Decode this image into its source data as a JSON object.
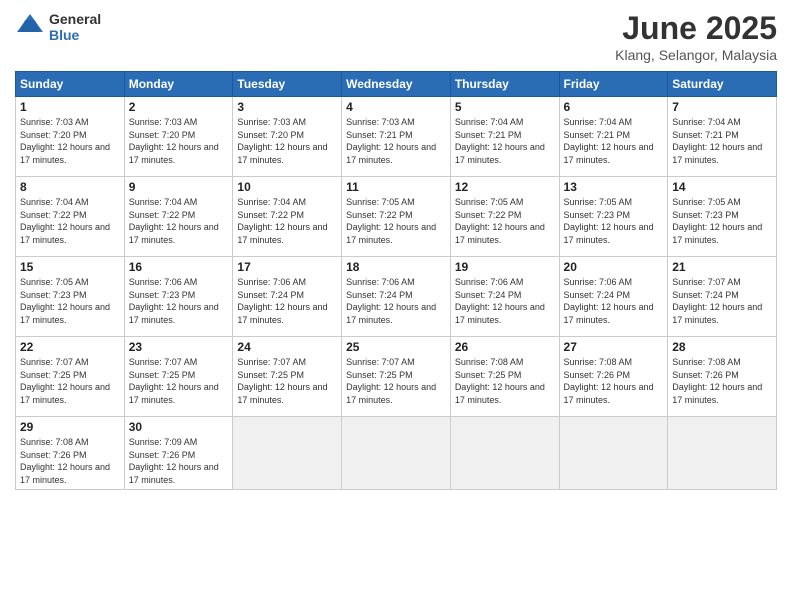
{
  "logo": {
    "general": "General",
    "blue": "Blue"
  },
  "title": "June 2025",
  "subtitle": "Klang, Selangor, Malaysia",
  "headers": [
    "Sunday",
    "Monday",
    "Tuesday",
    "Wednesday",
    "Thursday",
    "Friday",
    "Saturday"
  ],
  "weeks": [
    [
      {
        "day": "1",
        "rise": "7:03 AM",
        "set": "7:20 PM",
        "daylight": "12 hours and 17 minutes."
      },
      {
        "day": "2",
        "rise": "7:03 AM",
        "set": "7:20 PM",
        "daylight": "12 hours and 17 minutes."
      },
      {
        "day": "3",
        "rise": "7:03 AM",
        "set": "7:20 PM",
        "daylight": "12 hours and 17 minutes."
      },
      {
        "day": "4",
        "rise": "7:03 AM",
        "set": "7:21 PM",
        "daylight": "12 hours and 17 minutes."
      },
      {
        "day": "5",
        "rise": "7:04 AM",
        "set": "7:21 PM",
        "daylight": "12 hours and 17 minutes."
      },
      {
        "day": "6",
        "rise": "7:04 AM",
        "set": "7:21 PM",
        "daylight": "12 hours and 17 minutes."
      },
      {
        "day": "7",
        "rise": "7:04 AM",
        "set": "7:21 PM",
        "daylight": "12 hours and 17 minutes."
      }
    ],
    [
      {
        "day": "8",
        "rise": "7:04 AM",
        "set": "7:22 PM",
        "daylight": "12 hours and 17 minutes."
      },
      {
        "day": "9",
        "rise": "7:04 AM",
        "set": "7:22 PM",
        "daylight": "12 hours and 17 minutes."
      },
      {
        "day": "10",
        "rise": "7:04 AM",
        "set": "7:22 PM",
        "daylight": "12 hours and 17 minutes."
      },
      {
        "day": "11",
        "rise": "7:05 AM",
        "set": "7:22 PM",
        "daylight": "12 hours and 17 minutes."
      },
      {
        "day": "12",
        "rise": "7:05 AM",
        "set": "7:22 PM",
        "daylight": "12 hours and 17 minutes."
      },
      {
        "day": "13",
        "rise": "7:05 AM",
        "set": "7:23 PM",
        "daylight": "12 hours and 17 minutes."
      },
      {
        "day": "14",
        "rise": "7:05 AM",
        "set": "7:23 PM",
        "daylight": "12 hours and 17 minutes."
      }
    ],
    [
      {
        "day": "15",
        "rise": "7:05 AM",
        "set": "7:23 PM",
        "daylight": "12 hours and 17 minutes."
      },
      {
        "day": "16",
        "rise": "7:06 AM",
        "set": "7:23 PM",
        "daylight": "12 hours and 17 minutes."
      },
      {
        "day": "17",
        "rise": "7:06 AM",
        "set": "7:24 PM",
        "daylight": "12 hours and 17 minutes."
      },
      {
        "day": "18",
        "rise": "7:06 AM",
        "set": "7:24 PM",
        "daylight": "12 hours and 17 minutes."
      },
      {
        "day": "19",
        "rise": "7:06 AM",
        "set": "7:24 PM",
        "daylight": "12 hours and 17 minutes."
      },
      {
        "day": "20",
        "rise": "7:06 AM",
        "set": "7:24 PM",
        "daylight": "12 hours and 17 minutes."
      },
      {
        "day": "21",
        "rise": "7:07 AM",
        "set": "7:24 PM",
        "daylight": "12 hours and 17 minutes."
      }
    ],
    [
      {
        "day": "22",
        "rise": "7:07 AM",
        "set": "7:25 PM",
        "daylight": "12 hours and 17 minutes."
      },
      {
        "day": "23",
        "rise": "7:07 AM",
        "set": "7:25 PM",
        "daylight": "12 hours and 17 minutes."
      },
      {
        "day": "24",
        "rise": "7:07 AM",
        "set": "7:25 PM",
        "daylight": "12 hours and 17 minutes."
      },
      {
        "day": "25",
        "rise": "7:07 AM",
        "set": "7:25 PM",
        "daylight": "12 hours and 17 minutes."
      },
      {
        "day": "26",
        "rise": "7:08 AM",
        "set": "7:25 PM",
        "daylight": "12 hours and 17 minutes."
      },
      {
        "day": "27",
        "rise": "7:08 AM",
        "set": "7:26 PM",
        "daylight": "12 hours and 17 minutes."
      },
      {
        "day": "28",
        "rise": "7:08 AM",
        "set": "7:26 PM",
        "daylight": "12 hours and 17 minutes."
      }
    ],
    [
      {
        "day": "29",
        "rise": "7:08 AM",
        "set": "7:26 PM",
        "daylight": "12 hours and 17 minutes."
      },
      {
        "day": "30",
        "rise": "7:09 AM",
        "set": "7:26 PM",
        "daylight": "12 hours and 17 minutes."
      },
      null,
      null,
      null,
      null,
      null
    ]
  ],
  "labels": {
    "sunrise": "Sunrise:",
    "sunset": "Sunset:",
    "daylight": "Daylight:"
  }
}
